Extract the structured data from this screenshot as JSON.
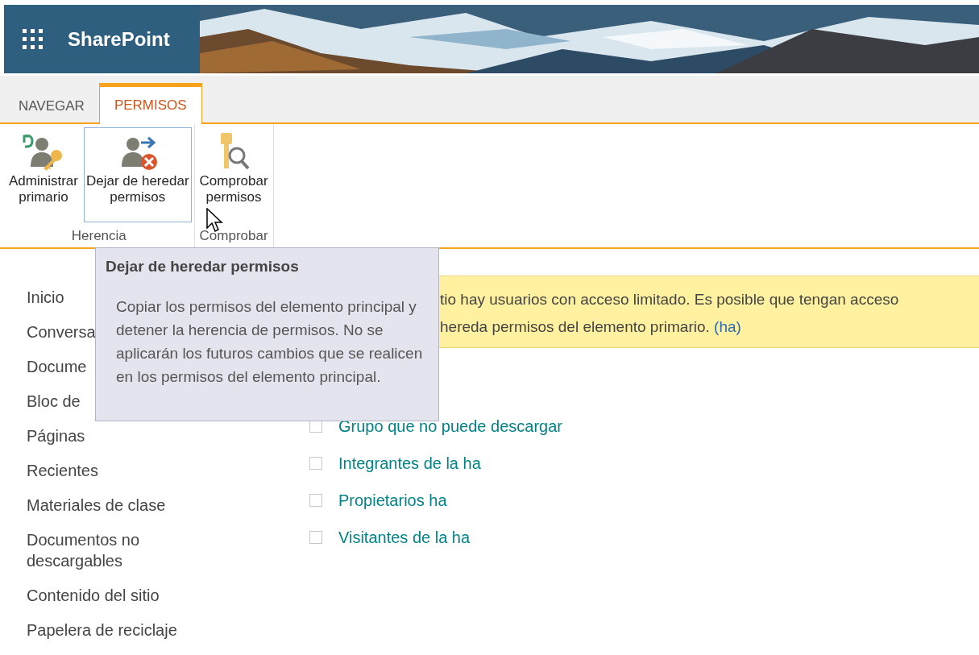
{
  "header": {
    "app_name": "SharePoint"
  },
  "tabs": [
    {
      "label": "NAVEGAR",
      "selected": false
    },
    {
      "label": "PERMISOS",
      "selected": true
    }
  ],
  "ribbon": {
    "groups": [
      {
        "label": "Herencia",
        "buttons": [
          {
            "kind": "manage-parent",
            "lines": [
              "Administrar",
              "primario"
            ],
            "hovered": false
          },
          {
            "kind": "stop-inherit",
            "lines": [
              "Dejar de heredar",
              "permisos"
            ],
            "hovered": true
          }
        ]
      },
      {
        "label": "Comprobar",
        "buttons": [
          {
            "kind": "check",
            "lines": [
              "Comprobar",
              "permisos"
            ],
            "hovered": false
          }
        ]
      }
    ]
  },
  "tooltip": {
    "title": "Dejar de heredar permisos",
    "text": "Copiar los permisos del elemento principal y detener la herencia de permisos. No se aplicarán los futuros cambios que se realicen en los permisos del elemento principal."
  },
  "nav": [
    "Inicio",
    "Conversa",
    "Docume",
    "Bloc de",
    "Páginas",
    "Recientes",
    "Materiales de clase",
    "Documentos no descargables",
    "Contenido del sitio",
    "Papelera de reciclaje"
  ],
  "banner": {
    "line_1": "tio hay usuarios con acceso limitado. Es posible que tengan acceso",
    "line_2": "hereda permisos del elemento primario.",
    "link": "(ha)"
  },
  "groups": [
    {
      "name": "Grupo que no puede descargar",
      "checked": false
    },
    {
      "name": "Integrantes de la ha",
      "checked": false
    },
    {
      "name": "Propietarios ha",
      "checked": false
    },
    {
      "name": "Visitantes de la ha",
      "checked": false
    }
  ]
}
